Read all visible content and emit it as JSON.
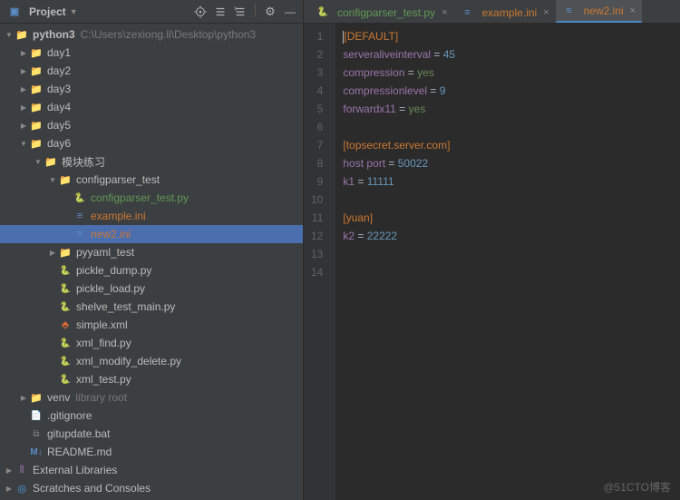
{
  "panel": {
    "title": "Project",
    "root": {
      "name": "python3",
      "path": "C:\\Users\\zexiong.li\\Desktop\\python3"
    },
    "days": [
      "day1",
      "day2",
      "day3",
      "day4",
      "day5",
      "day6"
    ],
    "day6": {
      "module_dir": "模块练习",
      "configparser": {
        "dir": "configparser_test",
        "files": {
          "py": "configparser_test.py",
          "ex": "example.ini",
          "n2": "new2.ini"
        }
      },
      "pyyaml_dir": "pyyaml_test",
      "scripts": [
        "pickle_dump.py",
        "pickle_load.py",
        "shelve_test_main.py",
        "simple.xml",
        "xml_find.py",
        "xml_modify_delete.py",
        "xml_test.py"
      ]
    },
    "venv": {
      "name": "venv",
      "hint": "library root"
    },
    "other": [
      ".gitignore",
      "gitupdate.bat",
      "README.md"
    ],
    "external": "External Libraries",
    "scratches": "Scratches and Consoles"
  },
  "tabs": {
    "t1": "configparser_test.py",
    "t2": "example.ini",
    "t3": "new2.ini"
  },
  "code": {
    "l1_section": "[DEFAULT]",
    "l2_key": "serveraliveinterval",
    "l2_val": "45",
    "l3_key": "compression",
    "l3_val": "yes",
    "l4_key": "compressionlevel",
    "l4_val": "9",
    "l5_key": "forwardx11",
    "l5_val": "yes",
    "l7_section": "[topsecret.server.com]",
    "l8_key": "host port",
    "l8_val": "50022",
    "l9_key": "k1",
    "l9_val": "11111",
    "l11_section": "[yuan]",
    "l12_key": "k2",
    "l12_val": "22222"
  },
  "gutter": [
    "1",
    "2",
    "3",
    "4",
    "5",
    "6",
    "7",
    "8",
    "9",
    "10",
    "11",
    "12",
    "13",
    "14"
  ],
  "watermark": "@51CTO博客"
}
